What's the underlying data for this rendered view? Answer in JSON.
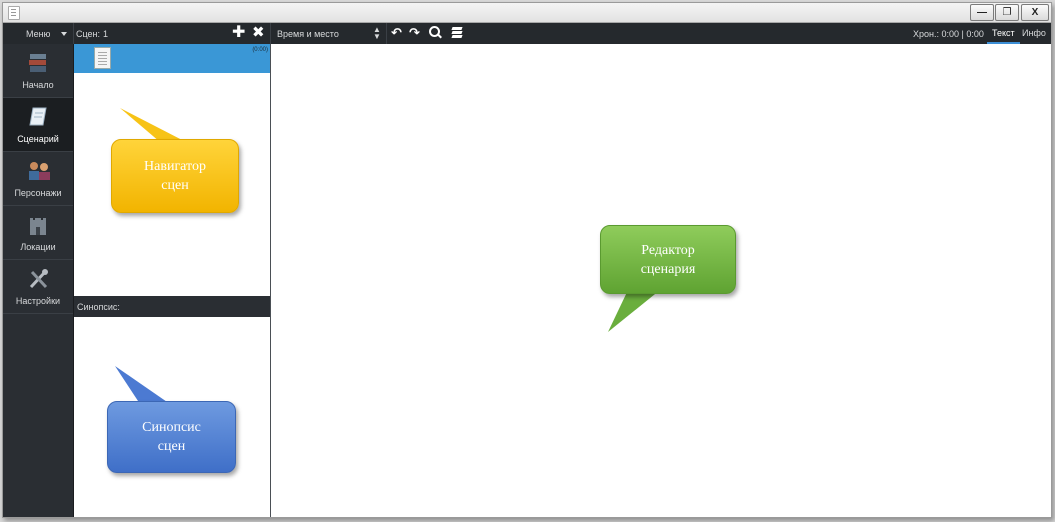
{
  "titlebar": {
    "minimize": "—",
    "maximize": "❐",
    "close": "X"
  },
  "toolbar": {
    "menu_label": "Меню",
    "scenes_label": "Сцен:",
    "scenes_count": "1",
    "add_icon": "plus-icon",
    "remove_icon": "close-icon",
    "heading_type": "Время и место",
    "chron_label": "Хрон.: 0:00 | 0:00",
    "tab_text": "Текст",
    "tab_info": "Инфо"
  },
  "sidebar": {
    "items": [
      {
        "label": "Начало",
        "icon": "books-icon",
        "active": false
      },
      {
        "label": "Сценарий",
        "icon": "scroll-icon",
        "active": true
      },
      {
        "label": "Персонажи",
        "icon": "people-icon",
        "active": false
      },
      {
        "label": "Локации",
        "icon": "castle-icon",
        "active": false
      },
      {
        "label": "Настройки",
        "icon": "tools-icon",
        "active": false
      }
    ]
  },
  "scene_list": {
    "items": [
      {
        "icon": "document-icon",
        "duration": "(0:00)"
      }
    ]
  },
  "synopsis": {
    "label": "Синопсис:"
  },
  "callouts": {
    "navigator": {
      "line1": "Навигатор",
      "line2": "сцен",
      "color": "#f5bd10"
    },
    "editor": {
      "line1": "Редактор",
      "line2": "сценария",
      "color": "#6fb541"
    },
    "synopsis": {
      "line1": "Синопсис",
      "line2": "сцен",
      "color": "#4a7bd0"
    }
  },
  "colors": {
    "accent": "#3a97d6",
    "dark_bg": "#2a2e33"
  }
}
